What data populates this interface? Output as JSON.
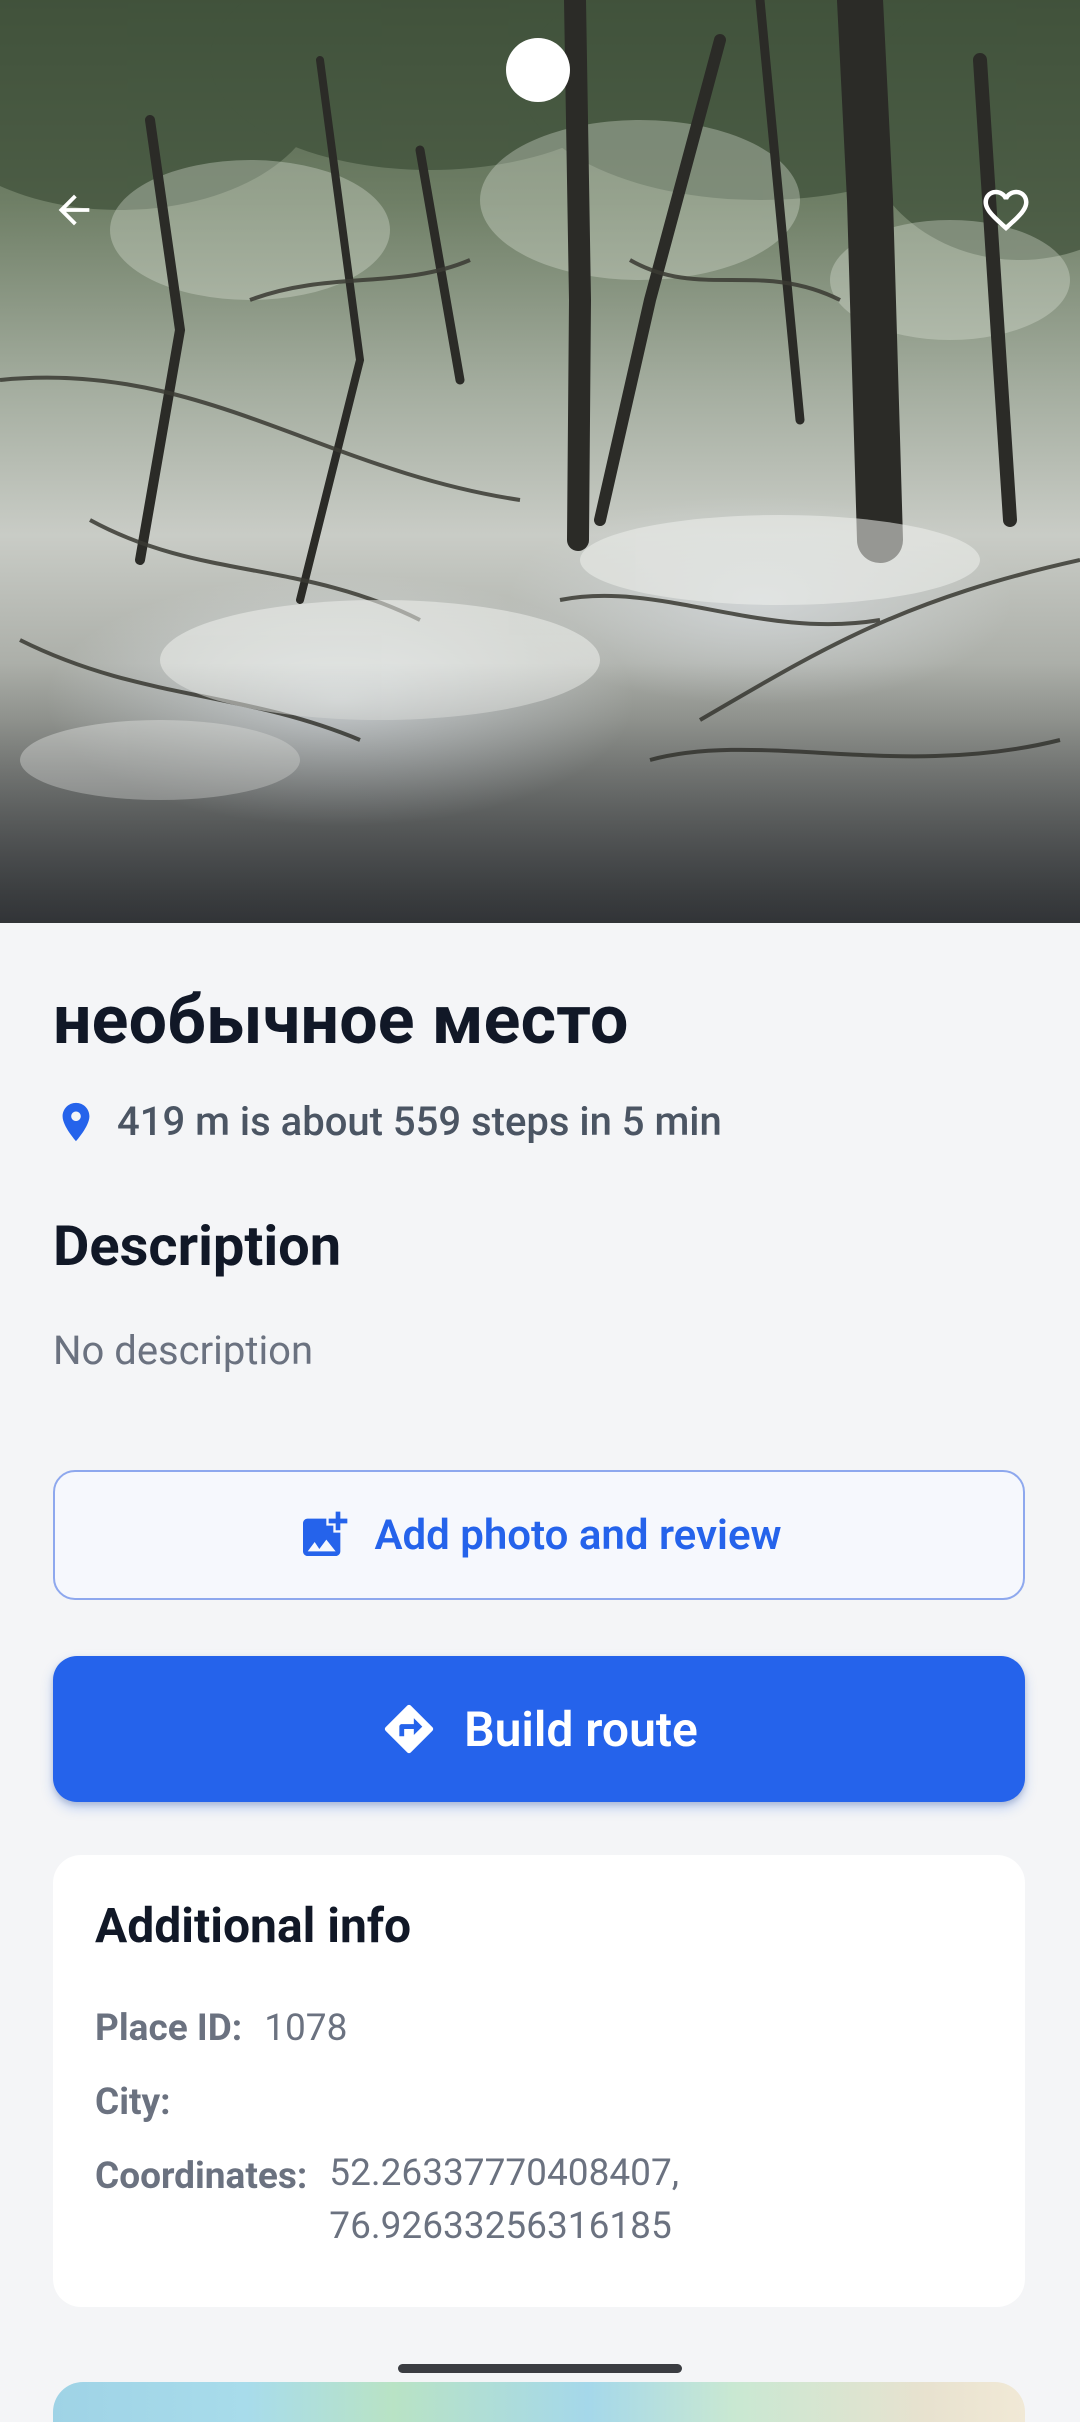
{
  "place": {
    "title": "необычное место",
    "distance_text": "419 m is about 559 steps in 5 min"
  },
  "description": {
    "heading": "Description",
    "text": "No description"
  },
  "actions": {
    "add_review_label": "Add photo and review",
    "build_route_label": "Build route"
  },
  "additional_info": {
    "heading": "Additional info",
    "place_id_label": "Place ID:",
    "place_id_value": "1078",
    "city_label": "City:",
    "city_value": "",
    "coordinates_label": "Coordinates:",
    "coordinates_line1": "52.26337770408407,",
    "coordinates_line2": "76.92633256316185"
  },
  "icons": {
    "back": "arrow-left-icon",
    "favorite": "heart-outline-icon",
    "location": "map-pin-icon",
    "add_photo": "add-photo-icon",
    "route": "directions-icon"
  },
  "colors": {
    "accent": "#2563eb",
    "outline_border": "#8ea8ee",
    "background": "#f4f5f7"
  }
}
